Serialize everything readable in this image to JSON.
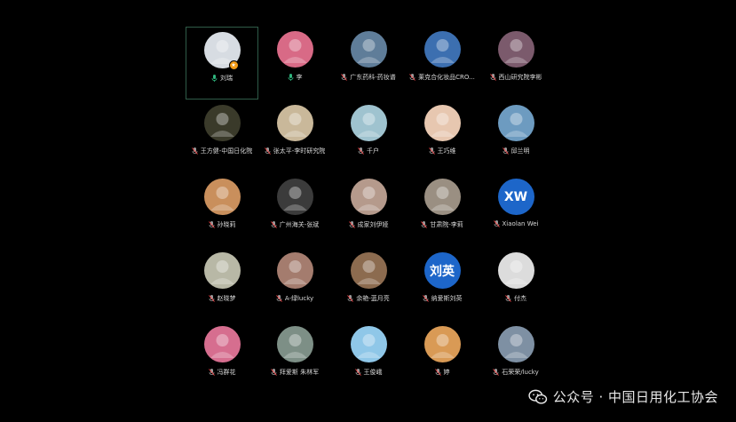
{
  "participants": [
    {
      "name": "刘瑞",
      "mic": "on",
      "active": true,
      "badge": "host",
      "avatar_bg": "#d7dce2",
      "avatar_icon": "cartoon-avatar"
    },
    {
      "name": "李",
      "mic": "on",
      "avatar_bg": "#d86a86",
      "avatar_icon": "photo-avatar"
    },
    {
      "name": "广东药科-药妆谱",
      "mic": "muted",
      "avatar_bg": "#5f7d99",
      "avatar_icon": "photo-avatar"
    },
    {
      "name": "莱克合化妆品CRO...",
      "mic": "muted",
      "avatar_bg": "#3c6fb0",
      "avatar_icon": "photo-avatar"
    },
    {
      "name": "西山研究院李彬",
      "mic": "muted",
      "avatar_bg": "#7b5a6c",
      "avatar_icon": "photo-avatar"
    },
    {
      "name": "王方健-中国日化院",
      "mic": "muted",
      "avatar_bg": "#3a3a2a",
      "avatar_icon": "photo-avatar"
    },
    {
      "name": "张太平-李时研究院",
      "mic": "muted",
      "avatar_bg": "#c9b89a",
      "avatar_icon": "photo-avatar"
    },
    {
      "name": "千户",
      "mic": "muted",
      "avatar_bg": "#9fc3cf",
      "avatar_icon": "photo-avatar"
    },
    {
      "name": "王巧维",
      "mic": "muted",
      "avatar_bg": "#e7c7b0",
      "avatar_icon": "cartoon-avatar"
    },
    {
      "name": "邱兰明",
      "mic": "muted",
      "avatar_bg": "#6d9bc0",
      "avatar_icon": "photo-avatar"
    },
    {
      "name": "孙晓莉",
      "mic": "muted",
      "avatar_bg": "#c98f5c",
      "avatar_icon": "photo-avatar"
    },
    {
      "name": "广州海关-张斌",
      "mic": "muted",
      "avatar_bg": "#3b3b3b",
      "avatar_icon": "photo-avatar"
    },
    {
      "name": "成家刘伊娅",
      "mic": "muted",
      "avatar_bg": "#b59a8c",
      "avatar_icon": "photo-avatar"
    },
    {
      "name": "甘肃院-李莉",
      "mic": "muted",
      "avatar_bg": "#9a8f82",
      "avatar_icon": "cartoon-avatar"
    },
    {
      "name": "Xiaolan Wei",
      "mic": "muted",
      "avatar_bg": "#1d66c9",
      "initials": "XW"
    },
    {
      "name": "赵晓梦",
      "mic": "muted",
      "avatar_bg": "#b8b8a6",
      "avatar_icon": "photo-avatar"
    },
    {
      "name": "A-绿lucky",
      "mic": "muted",
      "avatar_bg": "#a47c6e",
      "avatar_icon": "photo-avatar"
    },
    {
      "name": "余艳-蓝月亮",
      "mic": "muted",
      "avatar_bg": "#8c6b4f",
      "avatar_icon": "photo-avatar"
    },
    {
      "name": "纳爱斯刘英",
      "mic": "muted",
      "avatar_bg": "#1d66c9",
      "initials": "刘英"
    },
    {
      "name": "付杰",
      "mic": "muted",
      "avatar_bg": "#dcdcdc",
      "avatar_icon": "cartoon-avatar"
    },
    {
      "name": "冯群花",
      "mic": "muted",
      "avatar_bg": "#d66e8f",
      "avatar_icon": "photo-avatar"
    },
    {
      "name": "拜爱斯 朱林军",
      "mic": "muted",
      "avatar_bg": "#7d8f86",
      "avatar_icon": "photo-avatar"
    },
    {
      "name": "王俊峨",
      "mic": "muted",
      "avatar_bg": "#8fc7e8",
      "avatar_icon": "photo-avatar"
    },
    {
      "name": "婷",
      "mic": "muted",
      "avatar_bg": "#d99a55",
      "avatar_icon": "cartoon-avatar"
    },
    {
      "name": "石荣荣/lucky",
      "mic": "muted",
      "avatar_bg": "#7e90a3",
      "avatar_icon": "photo-avatar"
    }
  ],
  "watermark": {
    "text": "公众号 · 中国日用化工协会",
    "icon": "wechat-icon"
  },
  "colors": {
    "background": "#000000",
    "active_border": "#2f5b48",
    "mic_on": "#2fb57e",
    "mic_muted": "#9a9a9a",
    "badge": "#f39b16"
  }
}
